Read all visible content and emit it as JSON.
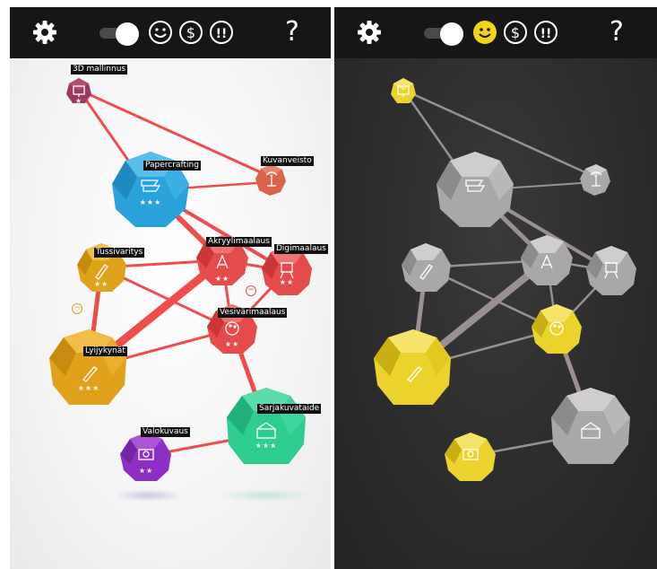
{
  "left_panel": {
    "toolbar": {
      "settings_icon": "gear-icon",
      "toggle_state": "on",
      "mode_icons": [
        "smiley-icon",
        "dollar-icon",
        "exclamation-icon"
      ],
      "help_label": "?"
    },
    "nodes": [
      {
        "label": "3D mallinnus",
        "stars": "★",
        "color": "#9b3a5e",
        "icon": "monitor-icon"
      },
      {
        "label": "Papercrafting",
        "stars": "★★★",
        "color": "#2aa3dc",
        "icon": "paper-icon"
      },
      {
        "label": "Kuvanveisto",
        "stars": "",
        "color": "#d9644a",
        "icon": "sculpture-icon"
      },
      {
        "label": "Tussivaritys",
        "stars": "★★",
        "color": "#e0a21a",
        "icon": "marker-icon"
      },
      {
        "label": "Akryylimaalaus",
        "stars": "★★",
        "color": "#e54b4b",
        "icon": "paint-tube-icon"
      },
      {
        "label": "Digimaalaus",
        "stars": "★★",
        "color": "#e54b4b",
        "icon": "easel-icon"
      },
      {
        "label": "Vesivärimaalaus",
        "stars": "★★",
        "color": "#e54b4b",
        "icon": "palette-icon"
      },
      {
        "label": "Lyijykynät",
        "stars": "★★★",
        "color": "#e0a21a",
        "icon": "pencil-icon"
      },
      {
        "label": "Sarjakuvataide",
        "stars": "★★★",
        "color": "#2ecc8f",
        "icon": "comic-icon"
      },
      {
        "label": "Valokuvaus",
        "stars": "★★",
        "color": "#8e2fc4",
        "icon": "camera-icon"
      }
    ],
    "minus_buttons": [
      "−",
      "−"
    ],
    "edge_color": "#ef4c4c"
  },
  "right_panel": {
    "toolbar": {
      "settings_icon": "gear-icon",
      "toggle_state": "on",
      "mode_icons": [
        "smiley-icon",
        "dollar-icon",
        "exclamation-icon"
      ],
      "active_mode": "smiley-icon",
      "active_color": "#f2d416",
      "help_label": "?"
    },
    "node_highlight_color": "#ecd22c",
    "node_base_color": "#a9a7a7",
    "edge_color": "#9a9090"
  }
}
